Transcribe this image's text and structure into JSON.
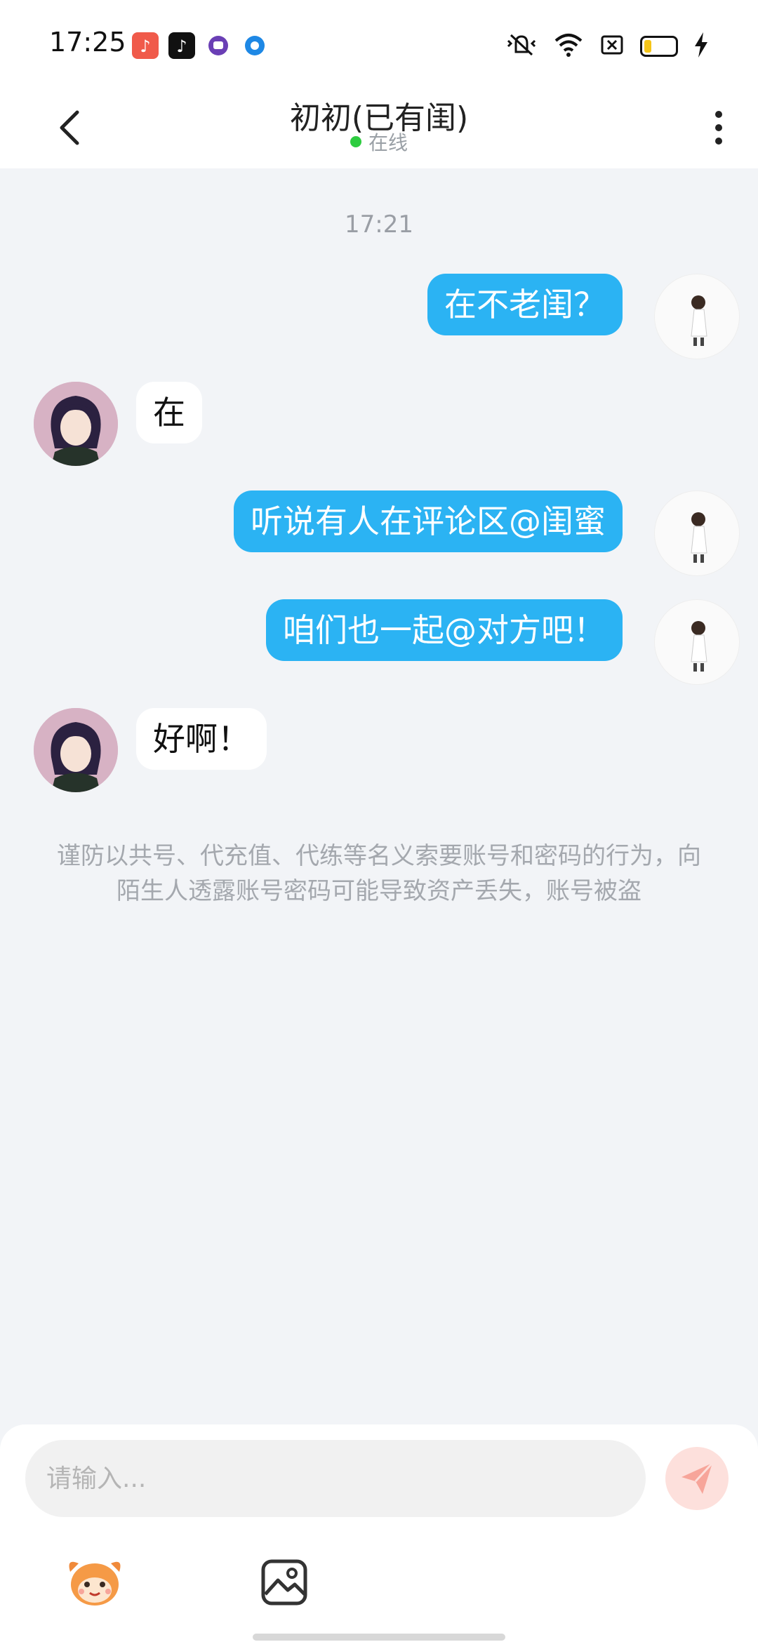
{
  "status_bar": {
    "time": "17:25",
    "app_icons": [
      "music-app-icon",
      "tiktok-icon",
      "chat-app-icon",
      "browser-icon"
    ],
    "system_icons": [
      "vibrate-mute-icon",
      "wifi-icon",
      "sim-off-icon",
      "battery-icon",
      "charging-icon"
    ],
    "battery_level": 0.2
  },
  "header": {
    "title": "初初(已有闺)",
    "status": "在线"
  },
  "chat": {
    "timestamp": "17:21",
    "messages": [
      {
        "from": "me",
        "text": "在不老闺？"
      },
      {
        "from": "her",
        "text": "在"
      },
      {
        "from": "me",
        "text": "听说有人在评论区@闺蜜"
      },
      {
        "from": "me",
        "text": "咱们也一起@对方吧！"
      },
      {
        "from": "her",
        "text": "好啊！"
      }
    ],
    "notice": "谨防以共号、代充值、代练等名义索要账号和密码的行为，向陌生人透露账号密码可能导致资产丢失，账号被盗"
  },
  "composer": {
    "placeholder": "请输入..."
  },
  "colors": {
    "my_bubble": "#2bb3f3",
    "online_dot": "#2ecc40",
    "background": "#f2f4f7"
  }
}
